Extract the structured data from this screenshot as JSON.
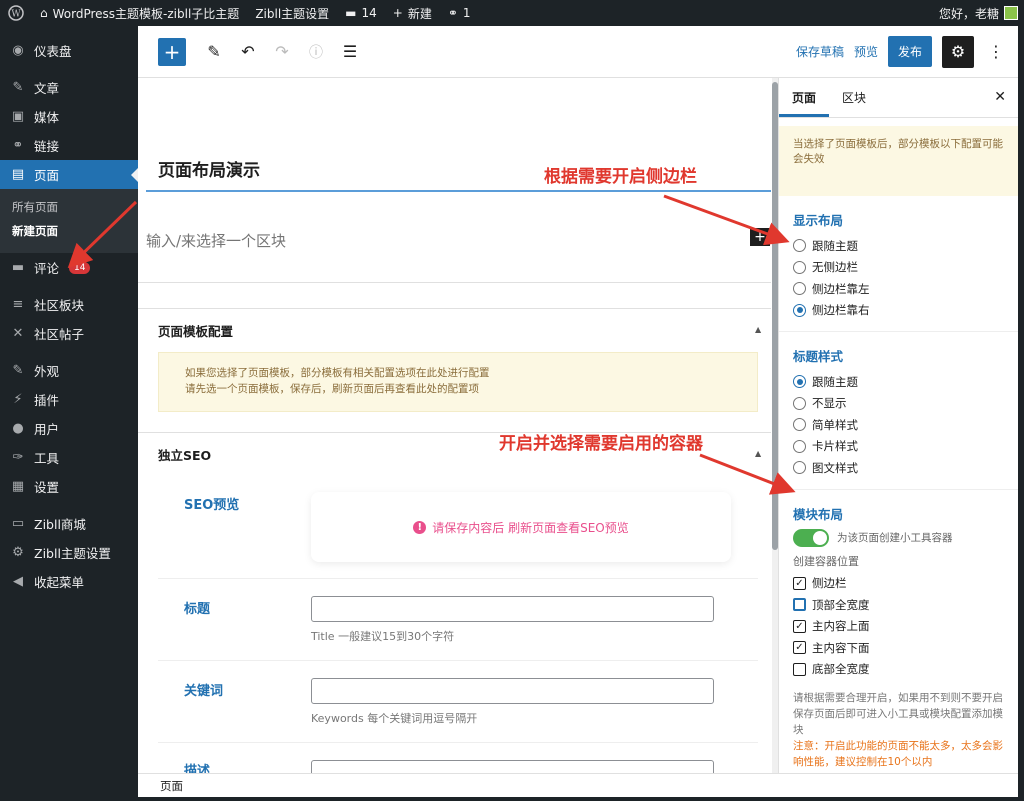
{
  "adminbar": {
    "wp_logo_icon": "wordpress-icon",
    "site_name": "WordPress主题模板-zibll子比主题",
    "theme_settings": "Zibll主题设置",
    "comments_count": "14",
    "new_label": "新建",
    "links_count": "1",
    "greeting": "您好，老糖"
  },
  "sidebar": {
    "items": [
      {
        "icon": "dashboard-icon",
        "glyph": "◉",
        "label": "仪表盘"
      },
      {
        "icon": "pin-icon",
        "glyph": "✎",
        "label": "文章"
      },
      {
        "icon": "media-icon",
        "glyph": "▣",
        "label": "媒体"
      },
      {
        "icon": "link-icon",
        "glyph": "⚭",
        "label": "链接"
      },
      {
        "icon": "pages-icon",
        "glyph": "▤",
        "label": "页面"
      },
      {
        "icon": "comment-icon",
        "glyph": "▬",
        "label": "评论",
        "badge": "14"
      },
      {
        "icon": "forum-icon",
        "glyph": "≡",
        "label": "社区板块"
      },
      {
        "icon": "posts-icon",
        "glyph": "✕",
        "label": "社区帖子"
      },
      {
        "icon": "appearance-icon",
        "glyph": "✎",
        "label": "外观"
      },
      {
        "icon": "plugins-icon",
        "glyph": "⚡",
        "label": "插件"
      },
      {
        "icon": "users-icon",
        "glyph": "●",
        "label": "用户"
      },
      {
        "icon": "tools-icon",
        "glyph": "✑",
        "label": "工具"
      },
      {
        "icon": "settings-icon",
        "glyph": "▦",
        "label": "设置"
      },
      {
        "icon": "shop-icon",
        "glyph": "▭",
        "label": "Zibll商城"
      },
      {
        "icon": "gear-icon",
        "glyph": "⚙",
        "label": "Zibll主题设置"
      },
      {
        "icon": "collapse-icon",
        "glyph": "◀",
        "label": "收起菜单"
      }
    ],
    "submenu": [
      "所有页面",
      "新建页面"
    ]
  },
  "toolbar": {
    "save_draft": "保存草稿",
    "preview": "预览",
    "publish": "发布"
  },
  "editor": {
    "title": "页面布局演示",
    "block_placeholder": "输入/来选择一个区块",
    "template_panel_title": "页面模板配置",
    "template_notice_line1": "如果您选择了页面模板，部分模板有相关配置选项在此处进行配置",
    "template_notice_line2": "请先选一个页面模板，保存后，刷新页面后再查看此处的配置项",
    "seo_panel_title": "独立SEO",
    "seo_preview_label": "SEO预览",
    "seo_preview_msg": "请保存内容后 刷新页面查看SEO预览",
    "field_title_label": "标题",
    "field_title_help": "Title 一般建议15到30个字符",
    "field_keywords_label": "关键词",
    "field_keywords_help": "Keywords 每个关键词用逗号隔开",
    "field_desc_label": "描述"
  },
  "statusbar": {
    "breadcrumb": "页面"
  },
  "inspector": {
    "tab_page": "页面",
    "tab_block": "区块",
    "notice": "当选择了页面模板后，部分模板以下配置可能会失效",
    "display_layout": {
      "title": "显示布局",
      "options": [
        "跟随主题",
        "无侧边栏",
        "侧边栏靠左",
        "侧边栏靠右"
      ],
      "selected": 3
    },
    "title_style": {
      "title": "标题样式",
      "options": [
        "跟随主题",
        "不显示",
        "简单样式",
        "卡片样式",
        "图文样式"
      ],
      "selected": 0
    },
    "module_layout": {
      "title": "模块布局",
      "toggle_label": "为该页面创建小工具容器",
      "toggle_on": true,
      "position_label": "创建容器位置",
      "positions": [
        {
          "label": "侧边栏",
          "checked": true
        },
        {
          "label": "顶部全宽度",
          "checked": false,
          "focused": true
        },
        {
          "label": "主内容上面",
          "checked": true
        },
        {
          "label": "主内容下面",
          "checked": true
        },
        {
          "label": "底部全宽度",
          "checked": false
        }
      ],
      "hint1": "请根据需要合理开启，如果用不到则不要开启",
      "hint2": "保存页面后即可进入小工具或模块配置添加模块",
      "warning": "注意：开启此功能的页面不能太多，太多会影响性能，建议控制在10个以内"
    }
  },
  "annotations": {
    "sidebar_tip": "根据需要开启侧边栏",
    "container_tip": "开启并选择需要启用的容器",
    "color": "#e0382e"
  }
}
